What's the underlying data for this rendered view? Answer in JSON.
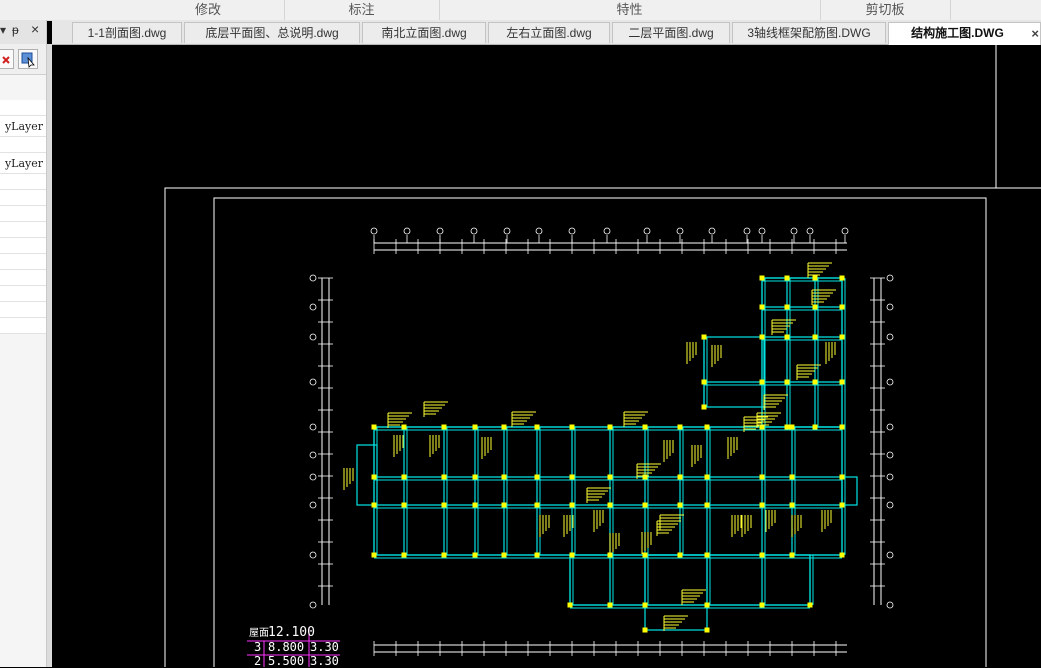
{
  "ribbon": {
    "groups": [
      "修改",
      "标注",
      "特性",
      "剪切板"
    ]
  },
  "tabs": [
    {
      "label": "1-1剖面图.dwg",
      "active": false
    },
    {
      "label": "底层平面图、总说明.dwg",
      "active": false
    },
    {
      "label": "南北立面图.dwg",
      "active": false
    },
    {
      "label": "左右立面图.dwg",
      "active": false
    },
    {
      "label": "二层平面图.dwg",
      "active": false
    },
    {
      "label": "3轴线框架配筋图.DWG",
      "active": false
    },
    {
      "label": "结构施工图.DWG",
      "active": true
    }
  ],
  "tab_close_glyph": "×",
  "left_panel": {
    "pin_glyph": "ᵽ",
    "close_glyph": "×",
    "header_glyph": "▾",
    "layer_values": [
      "yLayer",
      "yLayer"
    ]
  },
  "level_table": {
    "roof_label": "屋面",
    "roof_elev": "12.100",
    "rows": [
      {
        "floor": "3",
        "elev": "8.800",
        "height": "3.30"
      },
      {
        "floor": "2",
        "elev": "5.500",
        "height": "3.30"
      }
    ]
  },
  "colors": {
    "canvas_bg": "#000000",
    "structure": "#00e5e5",
    "column": "#ffff00",
    "rebar_label": "#ffff33",
    "border": "#ffffff",
    "level_lines": "#ff33ff"
  }
}
